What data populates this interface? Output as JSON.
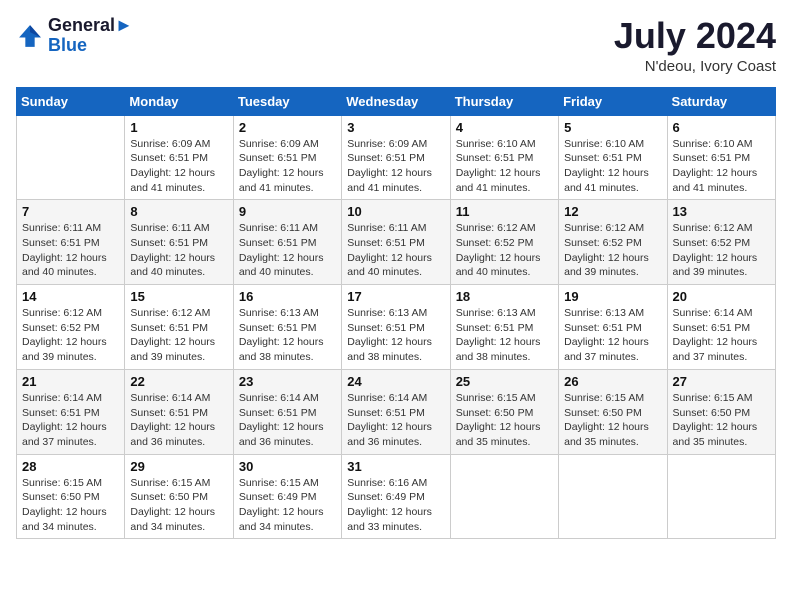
{
  "header": {
    "logo_line1": "General",
    "logo_line2": "Blue",
    "month": "July 2024",
    "location": "N'deou, Ivory Coast"
  },
  "weekdays": [
    "Sunday",
    "Monday",
    "Tuesday",
    "Wednesday",
    "Thursday",
    "Friday",
    "Saturday"
  ],
  "weeks": [
    [
      {
        "day": "",
        "sunrise": "",
        "sunset": "",
        "daylight": ""
      },
      {
        "day": "1",
        "sunrise": "6:09 AM",
        "sunset": "6:51 PM",
        "daylight": "12 hours and 41 minutes."
      },
      {
        "day": "2",
        "sunrise": "6:09 AM",
        "sunset": "6:51 PM",
        "daylight": "12 hours and 41 minutes."
      },
      {
        "day": "3",
        "sunrise": "6:09 AM",
        "sunset": "6:51 PM",
        "daylight": "12 hours and 41 minutes."
      },
      {
        "day": "4",
        "sunrise": "6:10 AM",
        "sunset": "6:51 PM",
        "daylight": "12 hours and 41 minutes."
      },
      {
        "day": "5",
        "sunrise": "6:10 AM",
        "sunset": "6:51 PM",
        "daylight": "12 hours and 41 minutes."
      },
      {
        "day": "6",
        "sunrise": "6:10 AM",
        "sunset": "6:51 PM",
        "daylight": "12 hours and 41 minutes."
      }
    ],
    [
      {
        "day": "7",
        "sunrise": "6:11 AM",
        "sunset": "6:51 PM",
        "daylight": "12 hours and 40 minutes."
      },
      {
        "day": "8",
        "sunrise": "6:11 AM",
        "sunset": "6:51 PM",
        "daylight": "12 hours and 40 minutes."
      },
      {
        "day": "9",
        "sunrise": "6:11 AM",
        "sunset": "6:51 PM",
        "daylight": "12 hours and 40 minutes."
      },
      {
        "day": "10",
        "sunrise": "6:11 AM",
        "sunset": "6:51 PM",
        "daylight": "12 hours and 40 minutes."
      },
      {
        "day": "11",
        "sunrise": "6:12 AM",
        "sunset": "6:52 PM",
        "daylight": "12 hours and 40 minutes."
      },
      {
        "day": "12",
        "sunrise": "6:12 AM",
        "sunset": "6:52 PM",
        "daylight": "12 hours and 39 minutes."
      },
      {
        "day": "13",
        "sunrise": "6:12 AM",
        "sunset": "6:52 PM",
        "daylight": "12 hours and 39 minutes."
      }
    ],
    [
      {
        "day": "14",
        "sunrise": "6:12 AM",
        "sunset": "6:52 PM",
        "daylight": "12 hours and 39 minutes."
      },
      {
        "day": "15",
        "sunrise": "6:12 AM",
        "sunset": "6:51 PM",
        "daylight": "12 hours and 39 minutes."
      },
      {
        "day": "16",
        "sunrise": "6:13 AM",
        "sunset": "6:51 PM",
        "daylight": "12 hours and 38 minutes."
      },
      {
        "day": "17",
        "sunrise": "6:13 AM",
        "sunset": "6:51 PM",
        "daylight": "12 hours and 38 minutes."
      },
      {
        "day": "18",
        "sunrise": "6:13 AM",
        "sunset": "6:51 PM",
        "daylight": "12 hours and 38 minutes."
      },
      {
        "day": "19",
        "sunrise": "6:13 AM",
        "sunset": "6:51 PM",
        "daylight": "12 hours and 37 minutes."
      },
      {
        "day": "20",
        "sunrise": "6:14 AM",
        "sunset": "6:51 PM",
        "daylight": "12 hours and 37 minutes."
      }
    ],
    [
      {
        "day": "21",
        "sunrise": "6:14 AM",
        "sunset": "6:51 PM",
        "daylight": "12 hours and 37 minutes."
      },
      {
        "day": "22",
        "sunrise": "6:14 AM",
        "sunset": "6:51 PM",
        "daylight": "12 hours and 36 minutes."
      },
      {
        "day": "23",
        "sunrise": "6:14 AM",
        "sunset": "6:51 PM",
        "daylight": "12 hours and 36 minutes."
      },
      {
        "day": "24",
        "sunrise": "6:14 AM",
        "sunset": "6:51 PM",
        "daylight": "12 hours and 36 minutes."
      },
      {
        "day": "25",
        "sunrise": "6:15 AM",
        "sunset": "6:50 PM",
        "daylight": "12 hours and 35 minutes."
      },
      {
        "day": "26",
        "sunrise": "6:15 AM",
        "sunset": "6:50 PM",
        "daylight": "12 hours and 35 minutes."
      },
      {
        "day": "27",
        "sunrise": "6:15 AM",
        "sunset": "6:50 PM",
        "daylight": "12 hours and 35 minutes."
      }
    ],
    [
      {
        "day": "28",
        "sunrise": "6:15 AM",
        "sunset": "6:50 PM",
        "daylight": "12 hours and 34 minutes."
      },
      {
        "day": "29",
        "sunrise": "6:15 AM",
        "sunset": "6:50 PM",
        "daylight": "12 hours and 34 minutes."
      },
      {
        "day": "30",
        "sunrise": "6:15 AM",
        "sunset": "6:49 PM",
        "daylight": "12 hours and 34 minutes."
      },
      {
        "day": "31",
        "sunrise": "6:16 AM",
        "sunset": "6:49 PM",
        "daylight": "12 hours and 33 minutes."
      },
      {
        "day": "",
        "sunrise": "",
        "sunset": "",
        "daylight": ""
      },
      {
        "day": "",
        "sunrise": "",
        "sunset": "",
        "daylight": ""
      },
      {
        "day": "",
        "sunrise": "",
        "sunset": "",
        "daylight": ""
      }
    ]
  ],
  "labels": {
    "sunrise_prefix": "Sunrise: ",
    "sunset_prefix": "Sunset: ",
    "daylight_prefix": "Daylight: "
  }
}
